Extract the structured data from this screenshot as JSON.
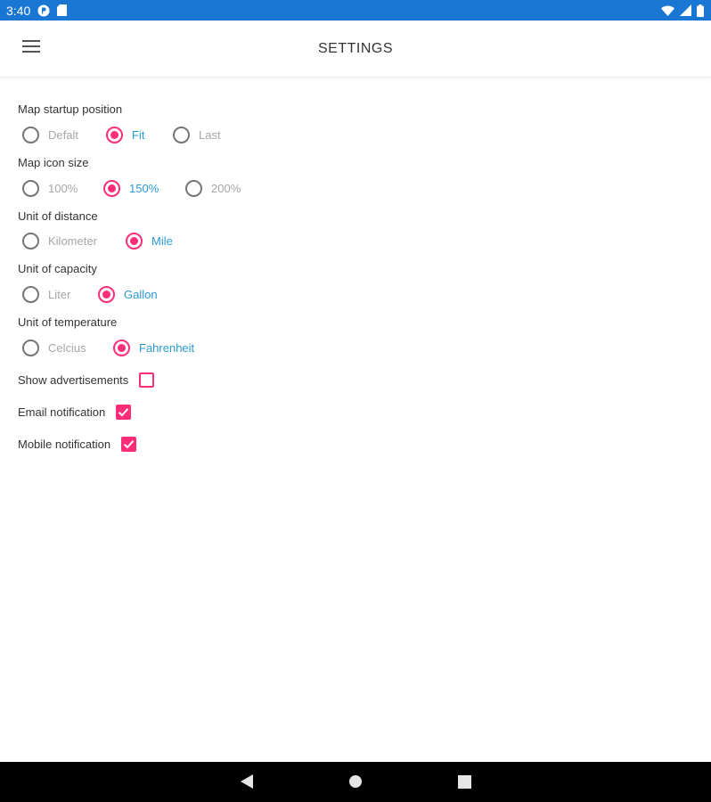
{
  "status_bar": {
    "time": "3:40"
  },
  "app_bar": {
    "title": "SETTINGS"
  },
  "settings": {
    "map_startup": {
      "label": "Map startup position",
      "options": [
        "Defalt",
        "Fit",
        "Last"
      ],
      "selected": "Fit"
    },
    "icon_size": {
      "label": "Map icon size",
      "options": [
        "100%",
        "150%",
        "200%"
      ],
      "selected": "150%"
    },
    "distance": {
      "label": "Unit of distance",
      "options": [
        "Kilometer",
        "Mile"
      ],
      "selected": "Mile"
    },
    "capacity": {
      "label": "Unit of capacity",
      "options": [
        "Liter",
        "Gallon"
      ],
      "selected": "Gallon"
    },
    "temperature": {
      "label": "Unit of temperature",
      "options": [
        "Celcius",
        "Fahrenheit"
      ],
      "selected": "Fahrenheit"
    },
    "show_ads": {
      "label": "Show advertisements",
      "checked": false
    },
    "email_notification": {
      "label": "Email notification",
      "checked": true
    },
    "mobile_notification": {
      "label": "Mobile notification",
      "checked": true
    }
  },
  "colors": {
    "status_bar": "#1976d2",
    "accent": "#ff2d78",
    "selected_text": "#2b9ad6",
    "unselected_text": "#a6a6a6",
    "nav_bar": "#000000"
  },
  "icons": {
    "status_left": [
      "p-badge-icon",
      "sd-card-icon"
    ],
    "status_right": [
      "wifi-icon",
      "signal-icon",
      "battery-icon"
    ],
    "app_bar": "hamburger-menu-icon",
    "nav": [
      "back-icon",
      "home-icon",
      "recents-icon"
    ]
  }
}
